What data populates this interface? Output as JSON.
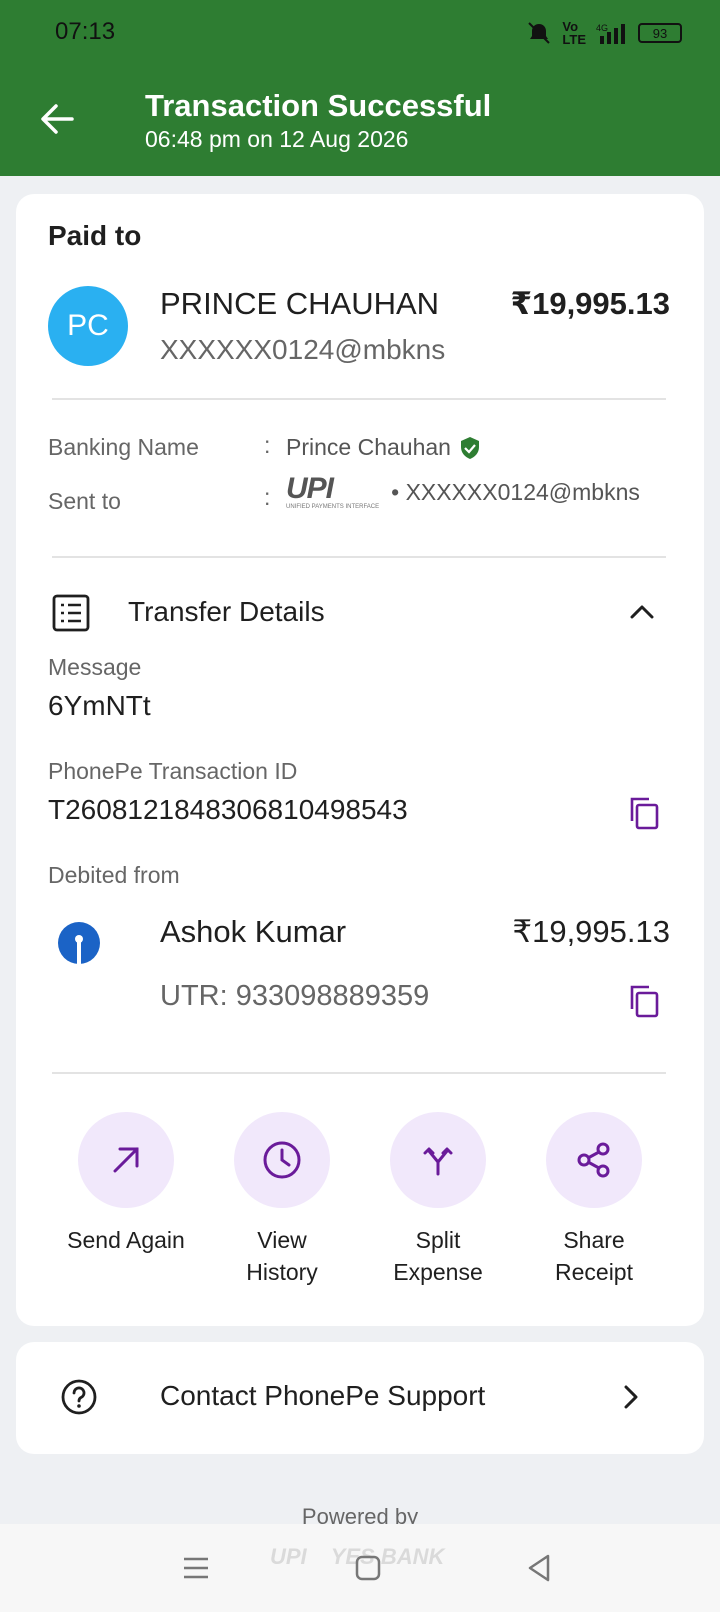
{
  "status_bar": {
    "time": "07:13",
    "battery": "93"
  },
  "header": {
    "title": "Transaction Successful",
    "subtitle": "06:48 pm on 12 Aug 2026"
  },
  "paid_to": {
    "heading": "Paid to",
    "avatar_initials": "PC",
    "name": "PRINCE CHAUHAN",
    "vpa": "XXXXXX0124@mbkns",
    "amount": "₹19,995.13"
  },
  "banking_name": {
    "label": "Banking Name",
    "colon": ":",
    "value": "Prince Chauhan"
  },
  "sent_to": {
    "label": "Sent to",
    "colon": ":",
    "logo_text": "UPI",
    "logo_sub": "UNIFIED PAYMENTS INTERFACE",
    "value": "• XXXXXX0124@mbkns"
  },
  "transfer_details": {
    "title": "Transfer Details",
    "message_label": "Message",
    "message_value": "6YmNTt",
    "txn_label": "PhonePe Transaction ID",
    "txn_value": "T2608121848306810498543",
    "debited_label": "Debited from",
    "account_name": "Ashok Kumar",
    "account_amount": "₹19,995.13",
    "utr": "UTR: 933098889359"
  },
  "actions": [
    {
      "label": "Send Again",
      "icon": "arrow-up-right-icon"
    },
    {
      "label": "View\nHistory",
      "icon": "clock-icon"
    },
    {
      "label": "Split\nExpense",
      "icon": "split-icon"
    },
    {
      "label": "Share\nReceipt",
      "icon": "share-icon"
    }
  ],
  "support": {
    "label": "Contact PhonePe Support"
  },
  "footer": {
    "powered_by": "Powered by",
    "partner_1": "UPI",
    "partner_2": "YES BANK"
  },
  "colors": {
    "header_bg": "#2e7d32",
    "accent": "#6a1b9a",
    "action_bg": "#f1e8fb",
    "verified": "#2e7d32"
  }
}
